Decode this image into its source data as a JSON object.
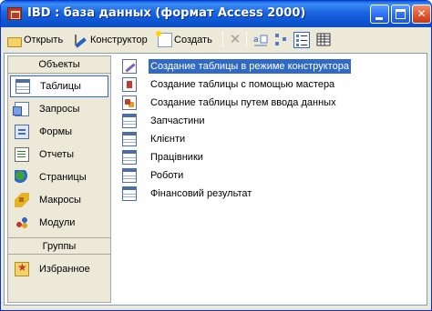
{
  "window": {
    "title": "IBD : база данных (формат Access 2000)",
    "controls": {
      "minimize": "",
      "maximize": "",
      "close": "✕"
    }
  },
  "toolbar": {
    "open_label": "Открыть",
    "design_label": "Конструктор",
    "new_label": "Создать",
    "delete_icon": "✕",
    "view_icons": [
      "large-icons",
      "small-icons",
      "list",
      "details"
    ],
    "active_view": "list"
  },
  "objects_pane": {
    "header": "Объекты",
    "items": [
      {
        "label": "Таблицы",
        "icon": "table-icon",
        "selected": true
      },
      {
        "label": "Запросы",
        "icon": "query-icon"
      },
      {
        "label": "Формы",
        "icon": "form-icon"
      },
      {
        "label": "Отчеты",
        "icon": "report-icon"
      },
      {
        "label": "Страницы",
        "icon": "page-icon"
      },
      {
        "label": "Макросы",
        "icon": "macro-icon"
      },
      {
        "label": "Модули",
        "icon": "module-icon"
      }
    ],
    "groups_header": "Группы",
    "groups": [
      {
        "label": "Избранное",
        "icon": "favorites-folder-icon"
      }
    ]
  },
  "table_list": [
    {
      "label": "Создание таблицы в режиме конструктора",
      "icon": "design-wizard-icon",
      "selected": true
    },
    {
      "label": "Создание таблицы с помощью мастера",
      "icon": "master-wizard-icon"
    },
    {
      "label": "Создание таблицы путем ввода данных",
      "icon": "data-entry-wizard-icon"
    },
    {
      "label": "Запчастини",
      "icon": "table-icon"
    },
    {
      "label": "Клієнти",
      "icon": "table-icon"
    },
    {
      "label": "Працівники",
      "icon": "table-icon"
    },
    {
      "label": "Роботи",
      "icon": "table-icon"
    },
    {
      "label": "Фінансовий результат",
      "icon": "table-icon"
    }
  ],
  "colors": {
    "titlebar": "#0a5fd8",
    "selection": "#316ac5",
    "pane_background": "#ece9d8"
  }
}
